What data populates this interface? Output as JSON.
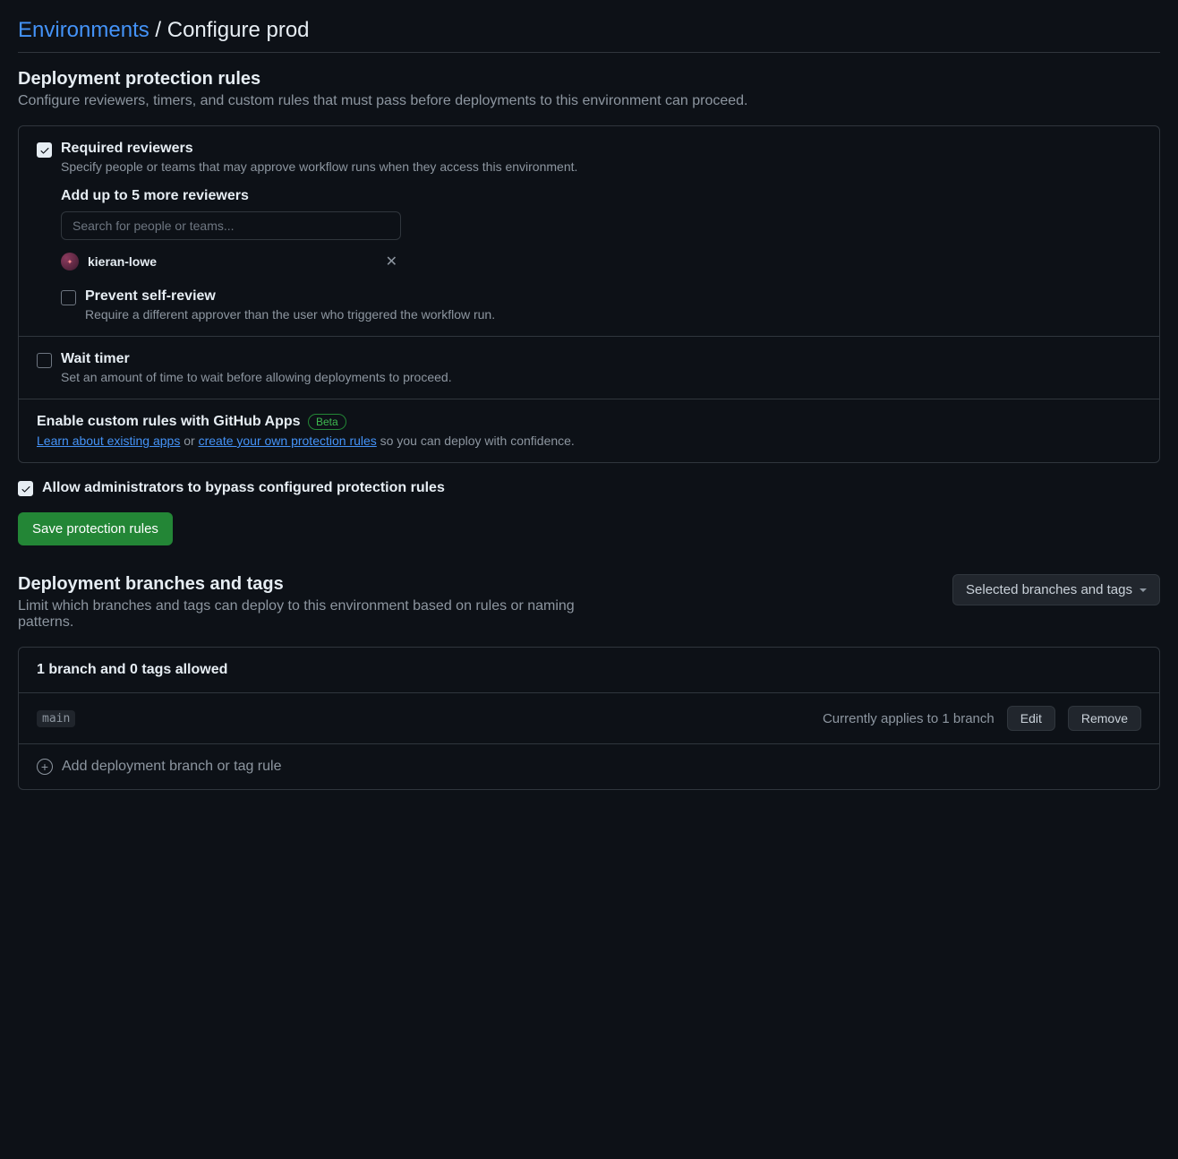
{
  "breadcrumb": {
    "parent": "Environments",
    "separator": " / ",
    "current": "Configure prod"
  },
  "protection": {
    "title": "Deployment protection rules",
    "desc": "Configure reviewers, timers, and custom rules that must pass before deployments to this environment can proceed.",
    "required_reviewers": {
      "checked": true,
      "label": "Required reviewers",
      "desc": "Specify people or teams that may approve workflow runs when they access this environment.",
      "add_label": "Add up to 5 more reviewers",
      "search_placeholder": "Search for people or teams...",
      "reviewer": "kieran-lowe",
      "prevent_self": {
        "checked": false,
        "label": "Prevent self-review",
        "desc": "Require a different approver than the user who triggered the workflow run."
      }
    },
    "wait_timer": {
      "checked": false,
      "label": "Wait timer",
      "desc": "Set an amount of time to wait before allowing deployments to proceed."
    },
    "custom_rules": {
      "title": "Enable custom rules with GitHub Apps",
      "badge": "Beta",
      "link1": "Learn about existing apps",
      "or": " or ",
      "link2": "create your own protection rules",
      "tail": " so you can deploy with confidence."
    },
    "allow_admins": {
      "checked": true,
      "label": "Allow administrators to bypass configured protection rules"
    },
    "save_button": "Save protection rules"
  },
  "branches": {
    "title": "Deployment branches and tags",
    "desc": "Limit which branches and tags can deploy to this environment based on rules or naming patterns.",
    "dropdown": "Selected branches and tags",
    "summary": "1 branch and 0 tags allowed",
    "items": [
      {
        "name": "main",
        "applies": "Currently applies to 1 branch"
      }
    ],
    "edit": "Edit",
    "remove": "Remove",
    "add_rule": "Add deployment branch or tag rule"
  }
}
